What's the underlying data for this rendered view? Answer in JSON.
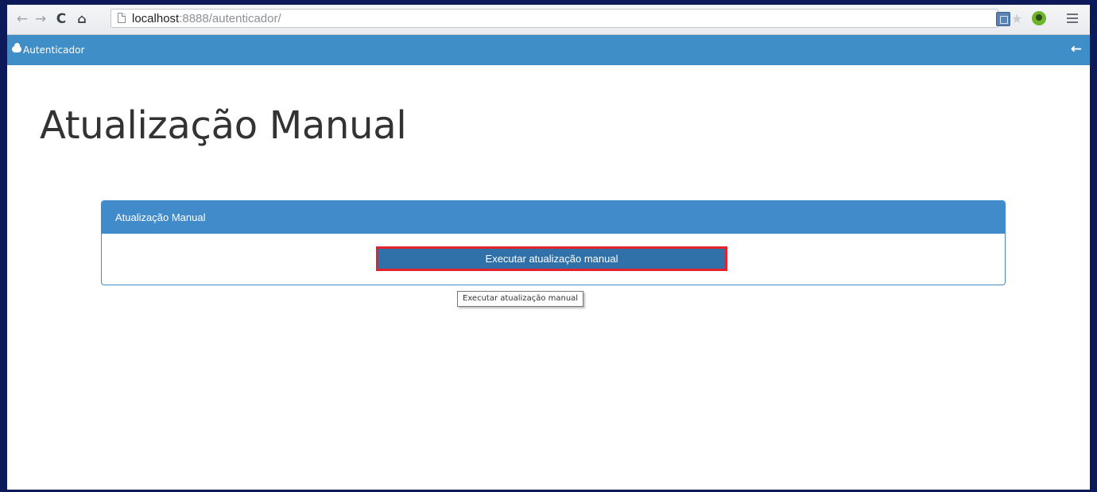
{
  "browser": {
    "url_host": "localhost",
    "url_rest": ":8888/autenticador/",
    "icons": {
      "back": "arrow-left-icon",
      "forward": "arrow-right-icon",
      "reload": "reload-icon",
      "home": "home-icon",
      "page": "page-icon",
      "translate": "translate-icon",
      "bookmark": "star-icon",
      "evernote": "evernote-icon",
      "menu": "menu-icon"
    }
  },
  "app": {
    "title": "Autenticador",
    "back_icon": "back-arrow-icon",
    "header_color": "#3f8ec8"
  },
  "page": {
    "title": "Atualização Manual"
  },
  "panel": {
    "heading": "Atualização Manual",
    "button_label": "Executar atualização manual",
    "tooltip": "Executar atualização manual",
    "accent_color": "#428bca",
    "highlight_color": "#e3222b"
  }
}
